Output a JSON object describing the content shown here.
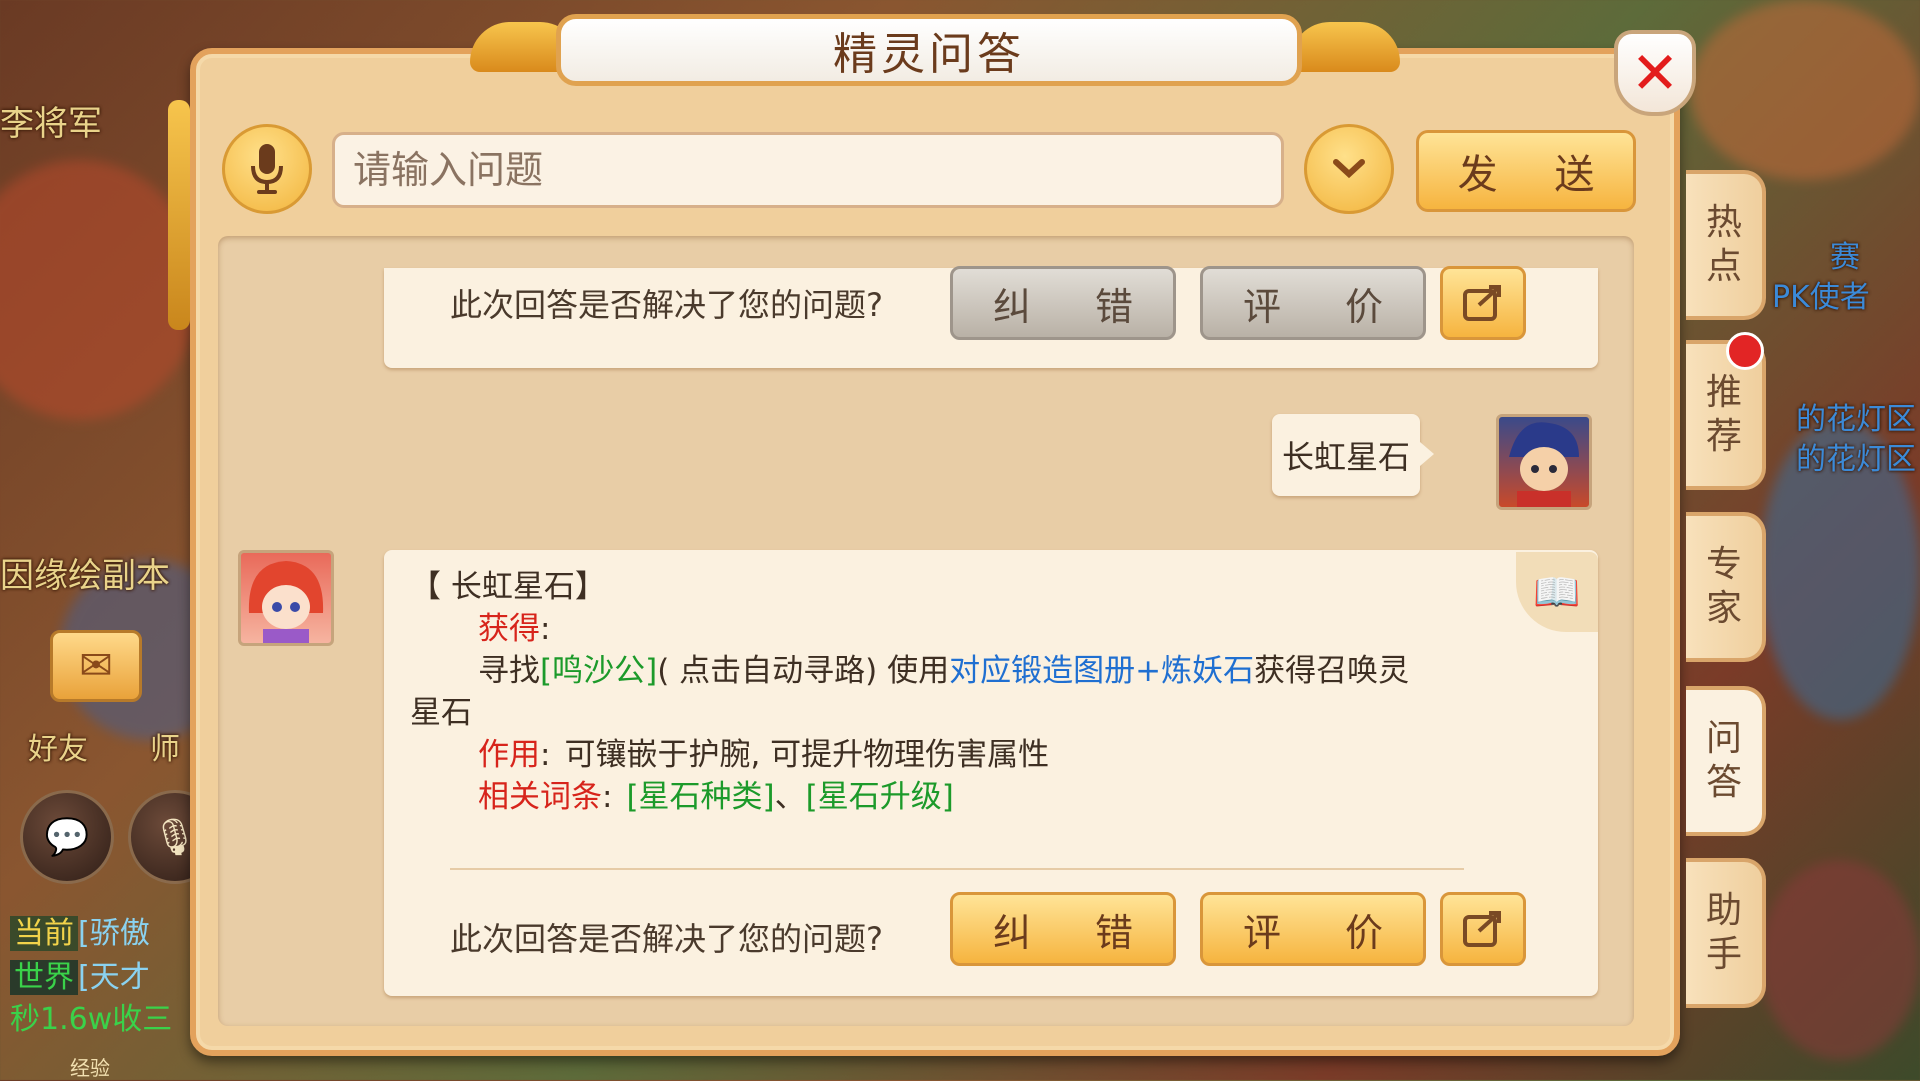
{
  "game": {
    "left_labels": [
      "李将军",
      "因缘绘副本",
      "好友",
      "师"
    ],
    "right_labels": [
      "赛",
      "PK使者",
      "的花灯区",
      "的花灯区"
    ],
    "chat": [
      {
        "channel": "当前",
        "text": "[骄傲"
      },
      {
        "channel": "世界",
        "text": "[天才"
      },
      {
        "channel": "",
        "text": "秒1.6w收三"
      }
    ],
    "bottom_label": "经验"
  },
  "dialog": {
    "title": "精灵问答",
    "close_icon": "close-icon",
    "search": {
      "placeholder": "请输入问题",
      "value": ""
    },
    "send_label": "发 送",
    "question_prompt": "此次回答是否解决了您的问题?",
    "correct_label": "纠 错",
    "rate_label": "评 价",
    "user_message": "长虹星石",
    "answer": {
      "heading": "【 长虹星石】",
      "obtain_label": "获得",
      "obtain_prefix": "寻找",
      "npc_link": "[鸣沙公]",
      "obtain_middle": "( 点击自动寻路) 使用",
      "item_link": "对应锻造图册+炼妖石",
      "obtain_suffix": "获得召唤灵",
      "obtain_suffix2": "星石",
      "effect_label": "作用",
      "effect_text": "可镶嵌于护腕, 可提升物理伤害属性",
      "related_label": "相关词条",
      "related_1": "[星石种类]",
      "related_sep": "、",
      "related_2": "[星石升级]",
      "colon": ":"
    }
  },
  "side_tabs": [
    {
      "label1": "热",
      "label2": "点"
    },
    {
      "label1": "推",
      "label2": "荐"
    },
    {
      "label1": "专",
      "label2": "家"
    },
    {
      "label1": "问",
      "label2": "答"
    },
    {
      "label1": "助",
      "label2": "手"
    }
  ],
  "colors": {
    "accent_gold": "#f6b43f",
    "panel_bg": "#f0cf9c",
    "link_red": "#d7241b",
    "link_green": "#1c9a2a",
    "link_blue": "#1f6fd1",
    "close_red": "#e31c1c"
  }
}
